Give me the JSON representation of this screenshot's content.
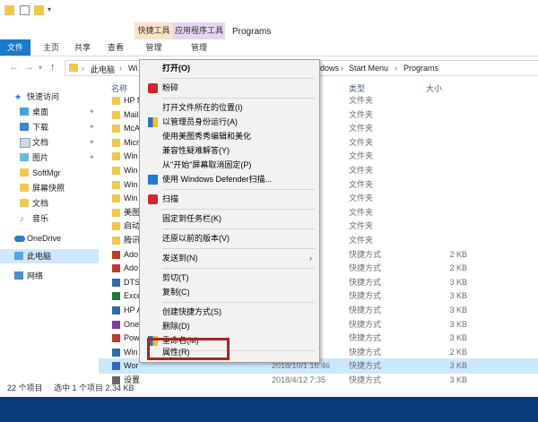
{
  "ribbon": {
    "file_tab": "文件",
    "tabs": [
      "主页",
      "共享",
      "查看"
    ],
    "ctx_quick": "快捷工具",
    "ctx_quick_sub": "管理",
    "ctx_app": "应用程序工具",
    "ctx_app_sub": "管理",
    "title": "Programs"
  },
  "address": {
    "seg1": "此电脑",
    "seg2": "Wi",
    "seg3": "dows",
    "seg4": "Start Menu",
    "seg5": "Programs"
  },
  "nav": {
    "items": [
      {
        "label": "快速访问"
      },
      {
        "label": "桌面"
      },
      {
        "label": "下载"
      },
      {
        "label": "文档"
      },
      {
        "label": "图片"
      },
      {
        "label": "SoftMgr"
      },
      {
        "label": "屏幕快照"
      },
      {
        "label": "文档"
      },
      {
        "label": "音乐"
      },
      {
        "label": "OneDrive"
      },
      {
        "label": "此电脑"
      },
      {
        "label": "网络"
      }
    ]
  },
  "columns": {
    "name": "名称",
    "type": "类型",
    "size": "大小"
  },
  "files": [
    {
      "name": "HP M",
      "date": ":19",
      "type": "文件夹",
      "size": ""
    },
    {
      "name": "Mail",
      "date": ":38",
      "type": "文件夹",
      "size": ""
    },
    {
      "name": "McA",
      "date": ":38",
      "type": "文件夹",
      "size": ""
    },
    {
      "name": "Micr",
      "date": ":46",
      "type": "文件夹",
      "size": ""
    },
    {
      "name": "Win",
      "date": "16:02",
      "type": "文件夹",
      "size": ""
    },
    {
      "name": "Win",
      "date": ":38",
      "type": "文件夹",
      "size": ""
    },
    {
      "name": "Win",
      "date": ":38",
      "type": "文件夹",
      "size": ""
    },
    {
      "name": "Win",
      "date": ":38",
      "type": "文件夹",
      "size": ""
    },
    {
      "name": "美图",
      "date": "15:50",
      "type": "文件夹",
      "size": ""
    },
    {
      "name": "启动",
      "date": ":46",
      "type": "文件夹",
      "size": ""
    },
    {
      "name": "腾讯",
      "date": "16:49",
      "type": "文件夹",
      "size": ""
    },
    {
      "name": "Ado",
      "date": "21:47",
      "type": "快捷方式",
      "size": "2 KB"
    },
    {
      "name": "Ado",
      "date": "22:22",
      "type": "快捷方式",
      "size": "2 KB"
    },
    {
      "name": "DTS",
      "date": ":38",
      "type": "快捷方式",
      "size": "3 KB"
    },
    {
      "name": "Exce",
      "date": ":46",
      "type": "快捷方式",
      "size": "3 KB"
    },
    {
      "name": "HP A",
      "date": ":19",
      "type": "快捷方式",
      "size": "3 KB"
    },
    {
      "name": "One",
      "date": ":46",
      "type": "快捷方式",
      "size": "3 KB"
    },
    {
      "name": "Pow",
      "date": ":46",
      "type": "快捷方式",
      "size": "3 KB"
    },
    {
      "name": "Win",
      "date": ":30",
      "type": "快捷方式",
      "size": "2 KB"
    },
    {
      "name": "Wor",
      "date": "2018/10/1 16:46",
      "type": "快捷方式",
      "size": "3 KB"
    },
    {
      "name": "设置",
      "date": "2018/4/12 7:35",
      "type": "快捷方式",
      "size": "3 KB"
    }
  ],
  "status": {
    "count": "22 个项目",
    "selected": "选中 1 个项目  2.34 KB"
  },
  "context_menu": {
    "open": "打开(O)",
    "shred": "粉碎",
    "open_location": "打开文件所在的位置(I)",
    "run_admin": "以管理员身份运行(A)",
    "meitu": "使用美图秀秀编辑和美化",
    "compat": "兼容性疑难解答(Y)",
    "unpin_start": "从\"开始\"屏幕取消固定(P)",
    "defender": "使用 Windows Defender扫描...",
    "scan": "扫描",
    "pin_taskbar": "固定到任务栏(K)",
    "restore": "还原以前的版本(V)",
    "send_to": "发送到(N)",
    "cut": "剪切(T)",
    "copy": "复制(C)",
    "create_shortcut": "创建快捷方式(S)",
    "delete": "删除(D)",
    "rename": "重命名(M)",
    "properties": "属性(R)"
  },
  "colors": {
    "accent": "#1979ca",
    "highlight_border": "#b22222",
    "selection": "#cce8ff"
  }
}
